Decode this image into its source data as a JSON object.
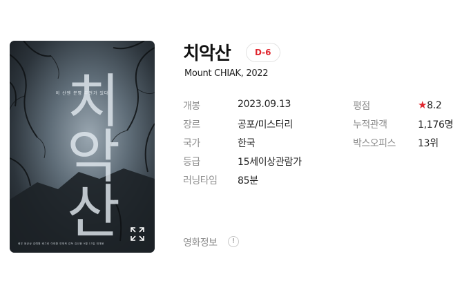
{
  "movie": {
    "title": "치악산",
    "dday_badge": "D-6",
    "subtitle": "Mount CHIAK, 2022",
    "poster": {
      "title_text": "치악산",
      "tagline": "이 산엔 분명 무언가 있다",
      "credits": "배우 윤균상 김예원 배그린 이태환 연제욱 감독 김선웅 9월 13일 대개봉",
      "expand_icon": "expand-icon"
    },
    "left_info": [
      {
        "label": "개봉",
        "value": "2023.09.13"
      },
      {
        "label": "장르",
        "value": "공포/미스터리"
      },
      {
        "label": "국가",
        "value": "한국"
      },
      {
        "label": "등급",
        "value": "15세이상관람가"
      },
      {
        "label": "러닝타임",
        "value": "85분"
      }
    ],
    "right_info": [
      {
        "label": "평점",
        "value": "8.2",
        "icon": "star-icon"
      },
      {
        "label": "누적관객",
        "value": "1,176명"
      },
      {
        "label": "박스오피스",
        "value": "13위"
      }
    ],
    "movie_info_link": "영화정보",
    "info_icon_glyph": "!"
  },
  "colors": {
    "accent_red": "#e0262e",
    "label_gray": "#8e8e8e",
    "text_dark": "#222222"
  }
}
